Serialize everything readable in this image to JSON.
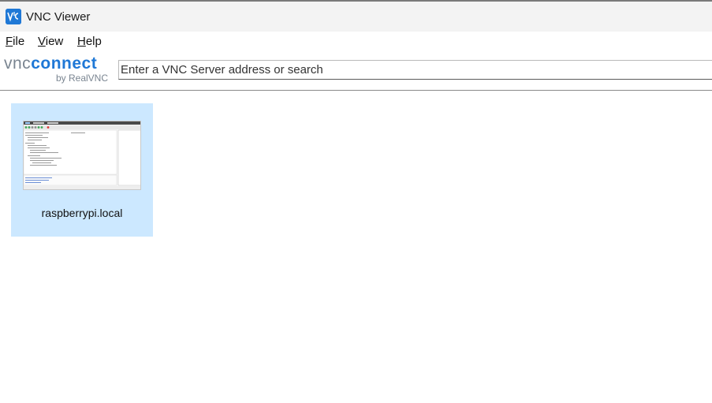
{
  "window": {
    "title": "VNC Viewer",
    "icon": "vnc-viewer-app-icon"
  },
  "menu": {
    "items": [
      {
        "label": "File",
        "mnemonic": "F",
        "rest": "ile"
      },
      {
        "label": "View",
        "mnemonic": "V",
        "rest": "iew"
      },
      {
        "label": "Help",
        "mnemonic": "H",
        "rest": "elp"
      }
    ]
  },
  "logo": {
    "vnc": "vnc",
    "connect": "connect",
    "sub": "by RealVNC"
  },
  "search": {
    "placeholder": "Enter a VNC Server address or search",
    "value": ""
  },
  "connections": [
    {
      "name": "raspberrypi.local",
      "selected": true
    }
  ],
  "colors": {
    "accent": "#1f78d6",
    "selection": "#cce8ff"
  }
}
